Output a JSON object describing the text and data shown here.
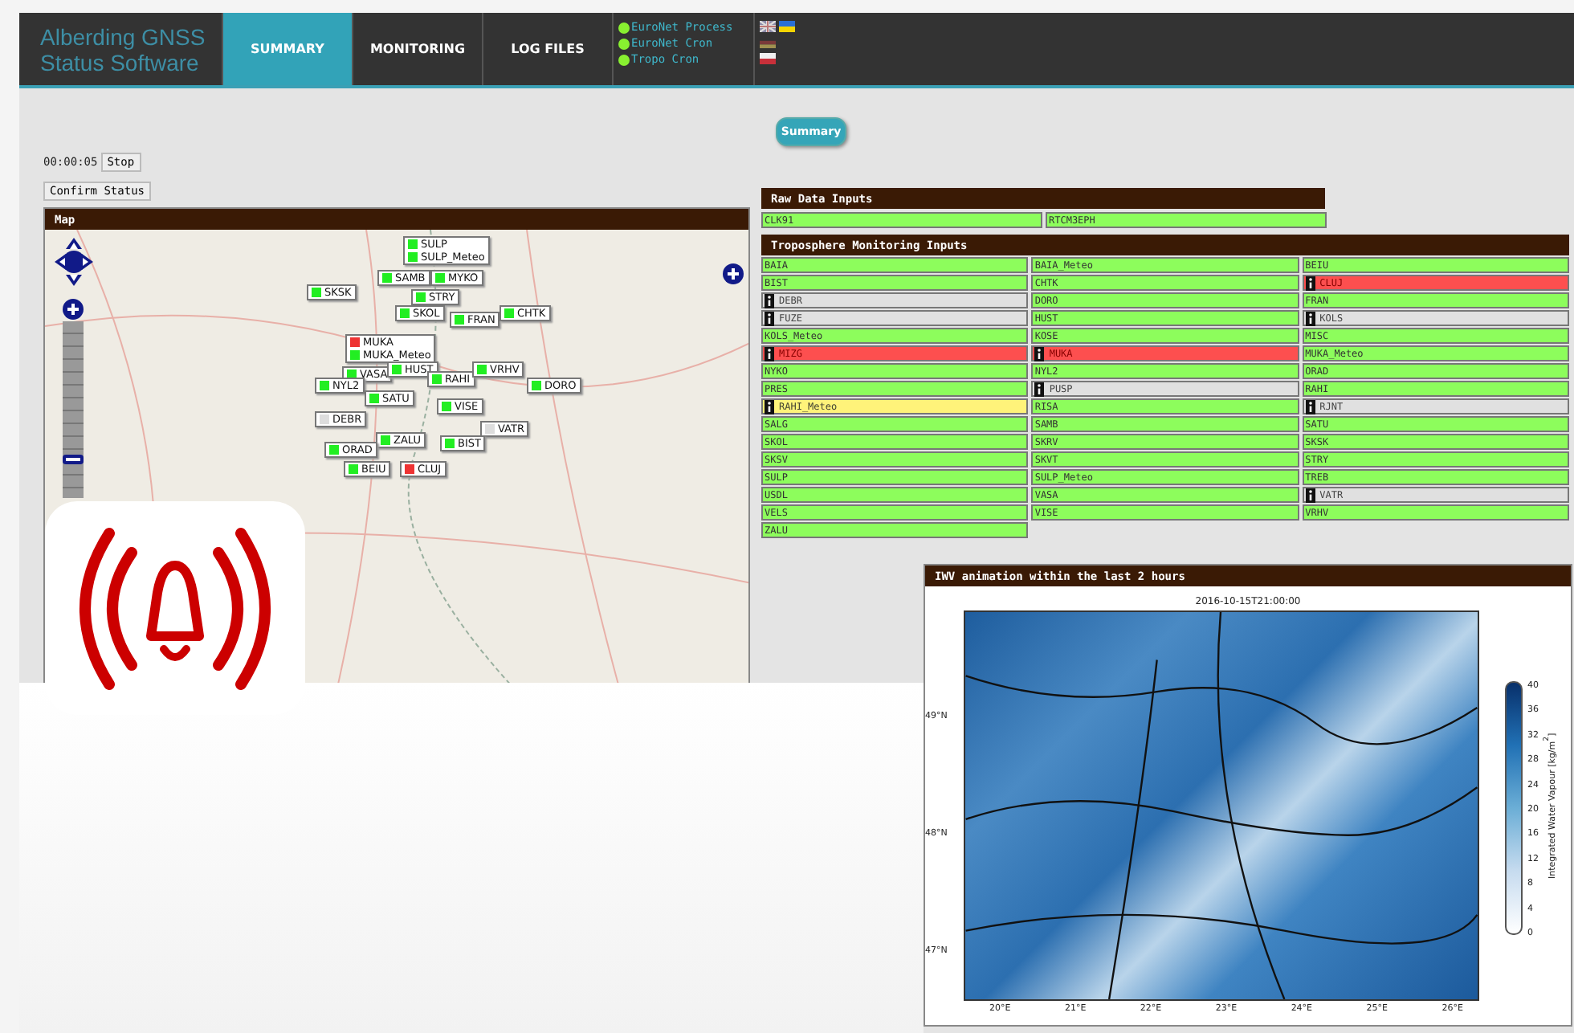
{
  "header": {
    "logo": [
      "Alberding GNSS",
      "Status Software"
    ],
    "tabs": [
      {
        "label": "SUMMARY",
        "selected": true
      },
      {
        "label": "MONITORING",
        "selected": false
      },
      {
        "label": "LOG FILES",
        "selected": false
      }
    ],
    "services": [
      {
        "label": "EuroNet Process",
        "color": "#88f030"
      },
      {
        "label": "EuroNet Cron",
        "color": "#88f030"
      },
      {
        "label": "Tropo Cron",
        "color": "#88f030"
      }
    ]
  },
  "summary_button": "Summary",
  "timer": "00:00:05",
  "stop_button": "Stop",
  "confirm_button": "Confirm Status",
  "map": {
    "title": "Map",
    "zoom_slider": {
      "level": 0.2
    },
    "markers": [
      {
        "entries": [
          {
            "label": "SULP",
            "color": "#22ee22"
          },
          {
            "label": "SULP_Meteo",
            "color": "#22ee22"
          }
        ]
      },
      {
        "entries": [
          {
            "label": "SAMB",
            "color": "#22ee22"
          }
        ]
      },
      {
        "entries": [
          {
            "label": "MYKO",
            "color": "#22ee22"
          }
        ]
      },
      {
        "entries": [
          {
            "label": "SKSK",
            "color": "#22ee22"
          }
        ]
      },
      {
        "entries": [
          {
            "label": "STRY",
            "color": "#22ee22"
          }
        ]
      },
      {
        "entries": [
          {
            "label": "SKOL",
            "color": "#22ee22"
          }
        ]
      },
      {
        "entries": [
          {
            "label": "FRAN",
            "color": "#22ee22"
          }
        ]
      },
      {
        "entries": [
          {
            "label": "CHTK",
            "color": "#22ee22"
          }
        ]
      },
      {
        "entries": [
          {
            "label": "MUKA",
            "color": "#ee3333"
          },
          {
            "label": "MUKA_Meteo",
            "color": "#22ee22"
          }
        ]
      },
      {
        "entries": [
          {
            "label": "VASA",
            "color": "#22ee22"
          }
        ]
      },
      {
        "entries": [
          {
            "label": "HUST",
            "color": "#22ee22"
          }
        ]
      },
      {
        "entries": [
          {
            "label": "RAHI",
            "color": "#22ee22"
          }
        ]
      },
      {
        "entries": [
          {
            "label": "VRHV",
            "color": "#22ee22"
          }
        ]
      },
      {
        "entries": [
          {
            "label": "NYL2",
            "color": "#22ee22"
          }
        ]
      },
      {
        "entries": [
          {
            "label": "DORO",
            "color": "#22ee22"
          }
        ]
      },
      {
        "entries": [
          {
            "label": "SATU",
            "color": "#22ee22"
          }
        ]
      },
      {
        "entries": [
          {
            "label": "VISE",
            "color": "#22ee22"
          }
        ]
      },
      {
        "entries": [
          {
            "label": "DEBR",
            "color": "#dddddd"
          }
        ]
      },
      {
        "entries": [
          {
            "label": "VATR",
            "color": "#dddddd"
          }
        ]
      },
      {
        "entries": [
          {
            "label": "ZALU",
            "color": "#22ee22"
          }
        ]
      },
      {
        "entries": [
          {
            "label": "BIST",
            "color": "#22ee22"
          }
        ]
      },
      {
        "entries": [
          {
            "label": "ORAD",
            "color": "#22ee22"
          }
        ]
      },
      {
        "entries": [
          {
            "label": "BEIU",
            "color": "#22ee22"
          }
        ]
      },
      {
        "entries": [
          {
            "label": "CLUJ",
            "color": "#ee3333"
          }
        ]
      }
    ]
  },
  "raw_data": {
    "title": "Raw Data Inputs",
    "items": [
      {
        "label": "CLK91",
        "kind": "ok"
      },
      {
        "label": "RTCM3EPH",
        "kind": "ok"
      }
    ]
  },
  "tropo": {
    "title": "Troposphere Monitoring Inputs",
    "items": [
      {
        "label": "BAIA",
        "kind": "ok"
      },
      {
        "label": "BAIA_Meteo",
        "kind": "ok"
      },
      {
        "label": "BEIU",
        "kind": "ok"
      },
      {
        "label": "BIST",
        "kind": "ok"
      },
      {
        "label": "CHTK",
        "kind": "ok"
      },
      {
        "label": "CLUJ",
        "kind": "error"
      },
      {
        "label": "DEBR",
        "kind": "unknown"
      },
      {
        "label": "DORO",
        "kind": "ok"
      },
      {
        "label": "FRAN",
        "kind": "ok"
      },
      {
        "label": "FUZE",
        "kind": "unknown"
      },
      {
        "label": "HUST",
        "kind": "ok"
      },
      {
        "label": "KOLS",
        "kind": "unknown"
      },
      {
        "label": "KOLS_Meteo",
        "kind": "ok"
      },
      {
        "label": "KOSE",
        "kind": "ok"
      },
      {
        "label": "MISC",
        "kind": "ok"
      },
      {
        "label": "MIZG",
        "kind": "error"
      },
      {
        "label": "MUKA",
        "kind": "error"
      },
      {
        "label": "MUKA_Meteo",
        "kind": "ok"
      },
      {
        "label": "NYKO",
        "kind": "ok"
      },
      {
        "label": "NYL2",
        "kind": "ok"
      },
      {
        "label": "ORAD",
        "kind": "ok"
      },
      {
        "label": "PRES",
        "kind": "ok"
      },
      {
        "label": "PUSP",
        "kind": "unknown"
      },
      {
        "label": "RAHI",
        "kind": "ok"
      },
      {
        "label": "RAHI_Meteo",
        "kind": "warning"
      },
      {
        "label": "RISA",
        "kind": "ok"
      },
      {
        "label": "RJNT",
        "kind": "unknown"
      },
      {
        "label": "SALG",
        "kind": "ok"
      },
      {
        "label": "SAMB",
        "kind": "ok"
      },
      {
        "label": "SATU",
        "kind": "ok"
      },
      {
        "label": "SKOL",
        "kind": "ok"
      },
      {
        "label": "SKRV",
        "kind": "ok"
      },
      {
        "label": "SKSK",
        "kind": "ok"
      },
      {
        "label": "SKSV",
        "kind": "ok"
      },
      {
        "label": "SKVT",
        "kind": "ok"
      },
      {
        "label": "STRY",
        "kind": "ok"
      },
      {
        "label": "SULP",
        "kind": "ok"
      },
      {
        "label": "SULP_Meteo",
        "kind": "ok"
      },
      {
        "label": "TREB",
        "kind": "ok"
      },
      {
        "label": "USDL",
        "kind": "ok"
      },
      {
        "label": "VASA",
        "kind": "ok"
      },
      {
        "label": "VATR",
        "kind": "unknown"
      },
      {
        "label": "VELS",
        "kind": "ok"
      },
      {
        "label": "VISE",
        "kind": "ok"
      },
      {
        "label": "VRHV",
        "kind": "ok"
      },
      {
        "label": "ZALU",
        "kind": "ok"
      }
    ]
  },
  "iwv": {
    "title": "IWV animation within the last 2 hours",
    "timestamp": "2016-10-15T21:00:00",
    "yticks": [
      "49°N",
      "48°N",
      "47°N"
    ],
    "xticks": [
      "20°E",
      "21°E",
      "22°E",
      "23°E",
      "24°E",
      "25°E",
      "26°E"
    ],
    "colorbar_ticks": [
      "40",
      "36",
      "32",
      "28",
      "24",
      "20",
      "16",
      "12",
      "8",
      "4",
      "0"
    ],
    "colorbar_label": "Integrated Water Vapour [kg/m$^{2}$]"
  }
}
